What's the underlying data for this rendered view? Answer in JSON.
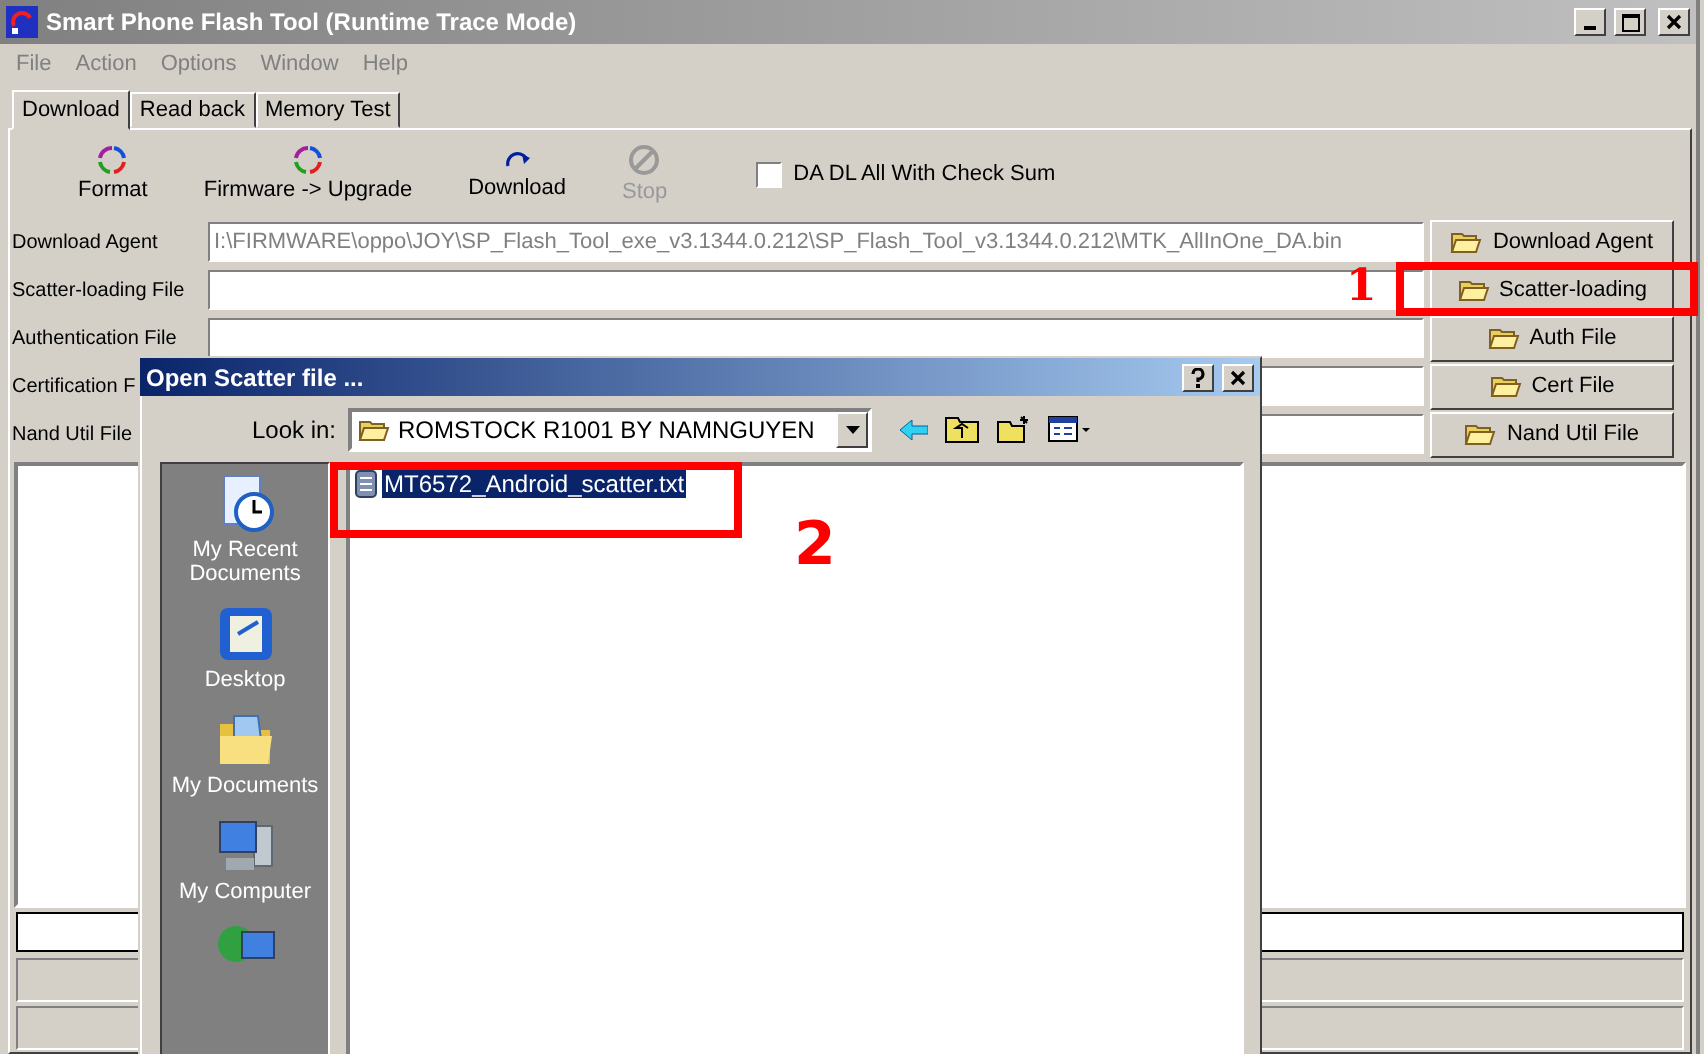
{
  "window": {
    "title": "Smart Phone Flash Tool (Runtime Trace Mode)"
  },
  "menu": [
    "File",
    "Action",
    "Options",
    "Window",
    "Help"
  ],
  "tabs": [
    {
      "label": "Download",
      "selected": true
    },
    {
      "label": "Read back",
      "selected": false
    },
    {
      "label": "Memory Test",
      "selected": false
    }
  ],
  "toolbar": [
    {
      "label": "Format",
      "kind": "format",
      "disabled": false
    },
    {
      "label": "Firmware -> Upgrade",
      "kind": "format",
      "disabled": false
    },
    {
      "label": "Download",
      "kind": "download",
      "disabled": false
    },
    {
      "label": "Stop",
      "kind": "stop",
      "disabled": true
    }
  ],
  "checksum": {
    "label": "DA DL All With Check Sum",
    "checked": false
  },
  "file_rows": [
    {
      "label": "Download Agent",
      "value": "I:\\FIRMWARE\\oppo\\JOY\\SP_Flash_Tool_exe_v3.1344.0.212\\SP_Flash_Tool_v3.1344.0.212\\MTK_AllInOne_DA.bin",
      "button": "Download Agent"
    },
    {
      "label": "Scatter-loading File",
      "button": "Scatter-loading"
    },
    {
      "label": "Authentication File",
      "button": "Auth File"
    },
    {
      "label": "Certification F",
      "button": "Cert File"
    },
    {
      "label": "Nand Util File",
      "button": "Nand Util File"
    }
  ],
  "dialog": {
    "title": "Open Scatter file ...",
    "look_in_label": "Look in:",
    "look_in_value": "ROMSTOCK R1001 BY NAMNGUYEN",
    "places": [
      {
        "label": "My Recent Documents",
        "kind": "recent"
      },
      {
        "label": "Desktop",
        "kind": "desktop"
      },
      {
        "label": "My Documents",
        "kind": "documents"
      },
      {
        "label": "My Computer",
        "kind": "computer"
      },
      {
        "kind": "network"
      }
    ],
    "files": [
      {
        "name": "MT6572_Android_scatter.txt",
        "selected": true
      }
    ]
  },
  "annotations": [
    {
      "label": "1",
      "kind": "button"
    },
    {
      "label": "2",
      "kind": "file"
    }
  ]
}
